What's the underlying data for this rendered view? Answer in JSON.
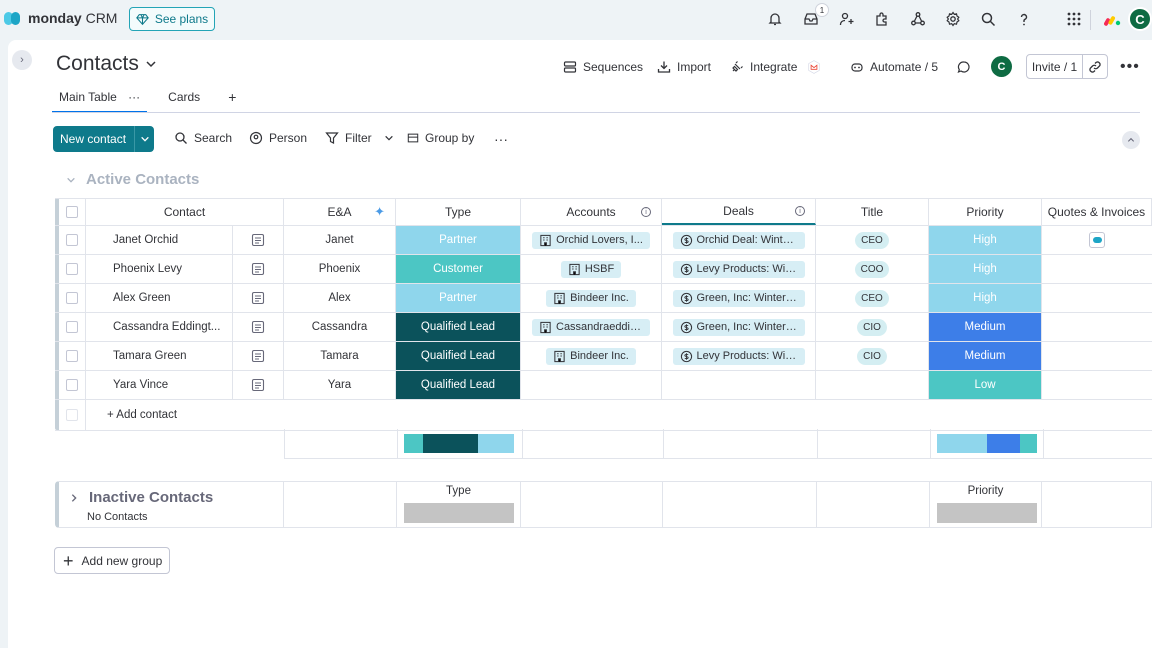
{
  "app": {
    "name": "monday",
    "suffix": "CRM",
    "see_plans": "See plans",
    "notif_count": "1",
    "avatar_initial": "C"
  },
  "page": {
    "title": "Contacts"
  },
  "header_actions": {
    "sequences": "Sequences",
    "import": "Import",
    "integrate": "Integrate",
    "automate": "Automate / 5",
    "invite": "Invite / 1"
  },
  "tabs": [
    {
      "label": "Main Table"
    },
    {
      "label": "Cards"
    }
  ],
  "toolbar": {
    "new_contact": "New contact",
    "search": "Search",
    "person": "Person",
    "filter": "Filter",
    "group_by": "Group by"
  },
  "groups": {
    "active": {
      "title": "Active Contacts",
      "add_item": "+ Add contact"
    },
    "inactive": {
      "title": "Inactive Contacts",
      "empty": "No Contacts",
      "col_type": "Type",
      "col_priority": "Priority"
    }
  },
  "columns": [
    "Contact",
    "E&A",
    "Type",
    "Accounts",
    "Deals",
    "Title",
    "Priority",
    "Quotes & Invoices"
  ],
  "rows": [
    {
      "contact": "Janet Orchid",
      "ea": "Janet",
      "type": "Partner",
      "account": "Orchid Lovers, I...",
      "deal": "Orchid Deal: Winte...",
      "title": "CEO",
      "priority": "High"
    },
    {
      "contact": "Phoenix Levy",
      "ea": "Phoenix",
      "type": "Customer",
      "account": "HSBF",
      "deal": "Levy Products: Win...",
      "title": "COO",
      "priority": "High"
    },
    {
      "contact": "Alex Green",
      "ea": "Alex",
      "type": "Partner",
      "account": "Bindeer Inc.",
      "deal": "Green, Inc: Winter ...",
      "title": "CEO",
      "priority": "High"
    },
    {
      "contact": "Cassandra Eddingt...",
      "ea": "Cassandra",
      "type": "Qualified Lead",
      "account": "Cassandraeddin...",
      "deal": "Green, Inc: Winter ...",
      "title": "CIO",
      "priority": "Medium"
    },
    {
      "contact": "Tamara Green",
      "ea": "Tamara",
      "type": "Qualified Lead",
      "account": "Bindeer Inc.",
      "deal": "Levy Products: Win...",
      "title": "CIO",
      "priority": "Medium"
    },
    {
      "contact": "Yara Vince",
      "ea": "Yara",
      "type": "Qualified Lead",
      "account": "",
      "deal": "",
      "title": "",
      "priority": "Low"
    }
  ],
  "colors": {
    "partner": "#8fd6ec",
    "customer": "#4cc6c4",
    "qualified_lead": "#0b525b",
    "high": "#8fd6ec",
    "medium": "#3d7ee8",
    "low": "#4cc6c4",
    "accent": "#0e7a8b"
  },
  "summary": {
    "type_distribution": [
      {
        "key": "customer",
        "fraction": 0.17
      },
      {
        "key": "qualified_lead",
        "fraction": 0.5
      },
      {
        "key": "partner",
        "fraction": 0.33
      }
    ],
    "priority_distribution": [
      {
        "key": "high",
        "fraction": 0.5
      },
      {
        "key": "medium",
        "fraction": 0.33
      },
      {
        "key": "low",
        "fraction": 0.17
      }
    ]
  },
  "add_group": "Add new group"
}
